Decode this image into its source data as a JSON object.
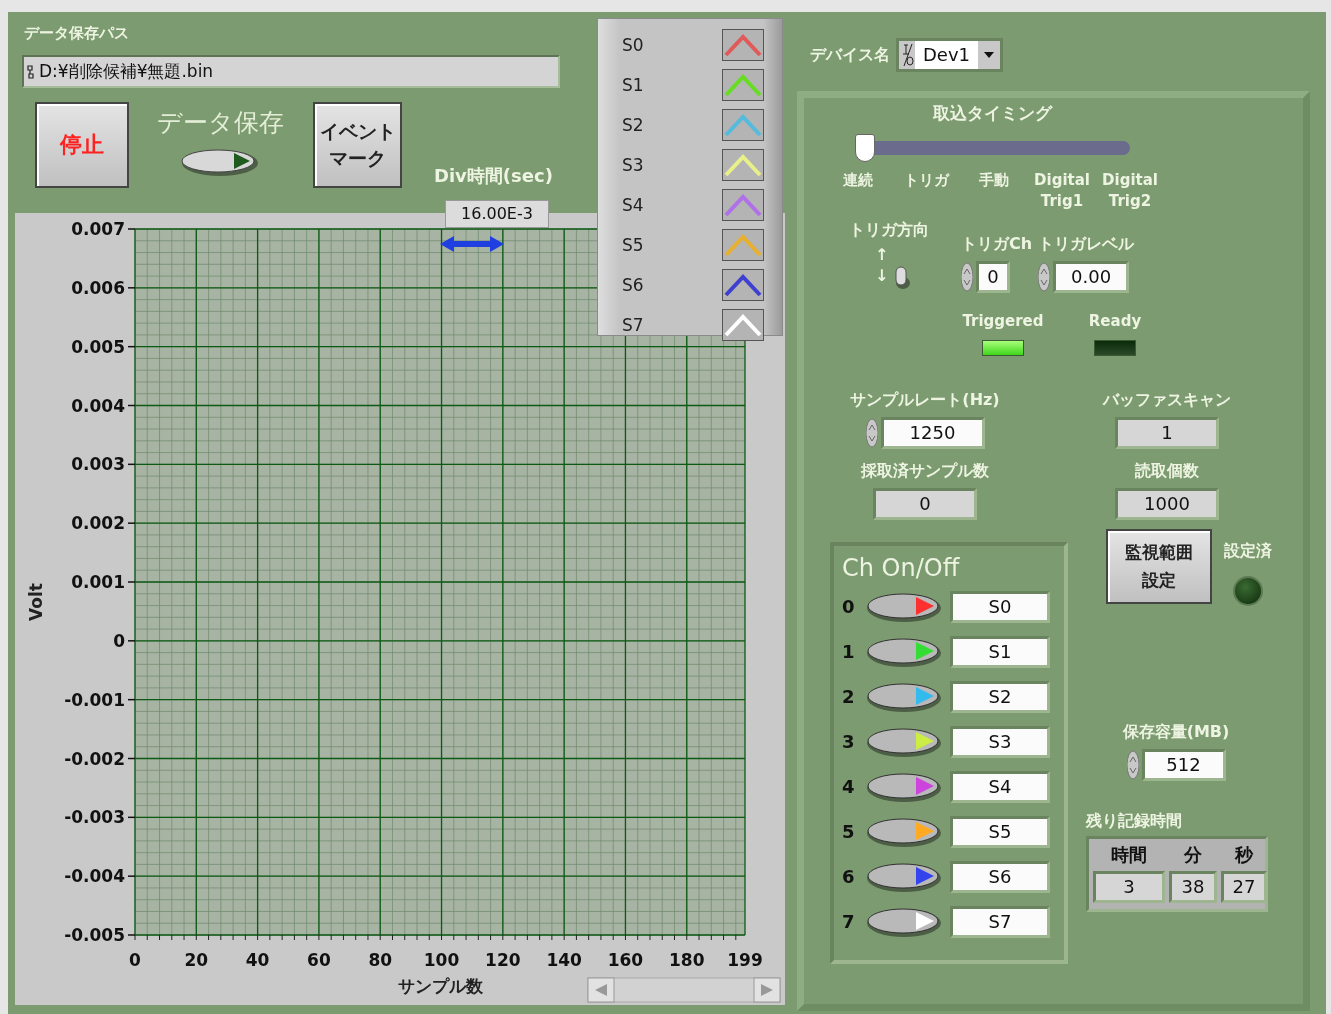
{
  "save_path": {
    "label": "データ保存パス",
    "value": "D:¥削除候補¥無題.bin"
  },
  "stop_button": "停止",
  "data_save": {
    "label": "データ保存",
    "on": true
  },
  "event_button": "イベントマーク",
  "div_time": {
    "label": "Div時間(sec)",
    "value": "16.00E-3"
  },
  "chart": {
    "chart_data": {
      "type": "line",
      "grid": true,
      "xlabel": "サンプル数",
      "ylabel": "Volt",
      "xlim": [
        0,
        199
      ],
      "ylim": [
        -0.005,
        0.007
      ],
      "xticks": [
        0,
        20,
        40,
        60,
        80,
        100,
        120,
        140,
        160,
        180,
        199
      ],
      "yticks": [
        0.007,
        0.006,
        0.005,
        0.004,
        0.003,
        0.002,
        0.001,
        0,
        -0.001,
        -0.002,
        -0.003,
        -0.004,
        -0.005
      ]
    },
    "legend": [
      {
        "name": "S0",
        "color": "#e05a5a"
      },
      {
        "name": "S1",
        "color": "#66dd22"
      },
      {
        "name": "S2",
        "color": "#55bbdd"
      },
      {
        "name": "S3",
        "color": "#e8f08a"
      },
      {
        "name": "S4",
        "color": "#b070e8"
      },
      {
        "name": "S5",
        "color": "#e8b030"
      },
      {
        "name": "S6",
        "color": "#4040d0"
      },
      {
        "name": "S7",
        "color": "#ffffff"
      }
    ]
  },
  "device": {
    "label": "デバイス名",
    "value": "Dev1"
  },
  "timing": {
    "title": "取込タイミング",
    "level": 0,
    "options": [
      "連続",
      "トリガ",
      "手動",
      "Digital\nTrig1",
      "Digital\nTrig2"
    ]
  },
  "trigger_direction": {
    "label": "トリガ方向",
    "up": "↑",
    "down": "↓",
    "on": false
  },
  "trigger_ch": {
    "label": "トリガCh",
    "value": "0"
  },
  "trigger_level": {
    "label": "トリガレベル",
    "value": "0.00"
  },
  "leds": [
    {
      "label": "Triggered",
      "on": true
    },
    {
      "label": "Ready",
      "on": false
    }
  ],
  "numerics": [
    {
      "label": "サンプルレート(Hz)",
      "value": "1250",
      "kind": "control"
    },
    {
      "label": "バッファスキャン",
      "value": "1",
      "kind": "indicator"
    },
    {
      "label": "採取済サンプル数",
      "value": "0",
      "kind": "indicator"
    },
    {
      "label": "読取個数",
      "value": "1000",
      "kind": "indicator"
    }
  ],
  "channels": {
    "title": "Ch On/Off",
    "items": [
      {
        "index": "0",
        "name": "S0",
        "color": "#ff3030",
        "on": true
      },
      {
        "index": "1",
        "name": "S1",
        "color": "#33dd33",
        "on": true
      },
      {
        "index": "2",
        "name": "S2",
        "color": "#33bbee",
        "on": true
      },
      {
        "index": "3",
        "name": "S3",
        "color": "#ccee44",
        "on": true
      },
      {
        "index": "4",
        "name": "S4",
        "color": "#cc44dd",
        "on": true
      },
      {
        "index": "5",
        "name": "S5",
        "color": "#ffaa22",
        "on": true
      },
      {
        "index": "6",
        "name": "S6",
        "color": "#3344ee",
        "on": true
      },
      {
        "index": "7",
        "name": "S7",
        "color": "#ffffff",
        "on": true
      }
    ]
  },
  "monitor_button": "監視範囲設定",
  "configured": {
    "label": "設定済",
    "on": false
  },
  "capacity": {
    "label": "保存容量(MB)",
    "value": "512"
  },
  "remaining": {
    "label": "残り記録時間",
    "columns": [
      "時間",
      "分",
      "秒"
    ],
    "values": [
      "3",
      "38",
      "27"
    ]
  }
}
